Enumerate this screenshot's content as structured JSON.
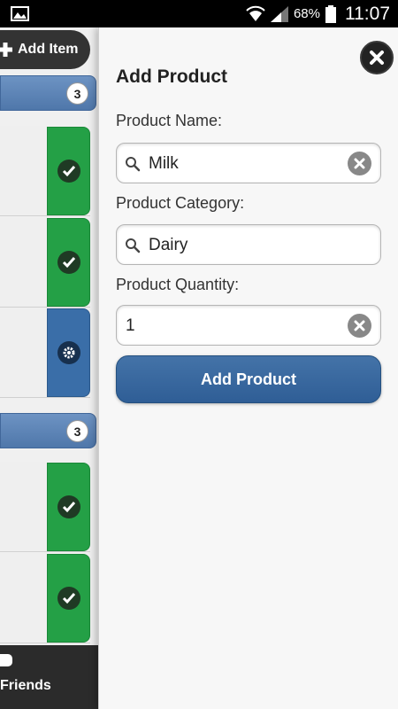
{
  "status_bar": {
    "battery_percent": "68%",
    "time": "11:07"
  },
  "background_list": {
    "add_item_label": "Add Item",
    "groups": [
      {
        "count": "3",
        "items": [
          {
            "action": "check-icon"
          },
          {
            "action": "check-icon"
          },
          {
            "action": "gear-icon"
          }
        ]
      },
      {
        "count": "3",
        "items": [
          {
            "action": "check-icon"
          },
          {
            "action": "check-icon"
          }
        ]
      }
    ],
    "bottom_nav_label": "Friends"
  },
  "panel": {
    "title": "Add Product",
    "product_name": {
      "label": "Product Name:",
      "value": "Milk"
    },
    "product_category": {
      "label": "Product Category:",
      "value": "Dairy"
    },
    "product_quantity": {
      "label": "Product Quantity:",
      "value": "1"
    },
    "submit_label": "Add Product"
  },
  "colors": {
    "accent_blue": "#3a6ea8",
    "check_green": "#24a046",
    "dark": "#222222"
  }
}
